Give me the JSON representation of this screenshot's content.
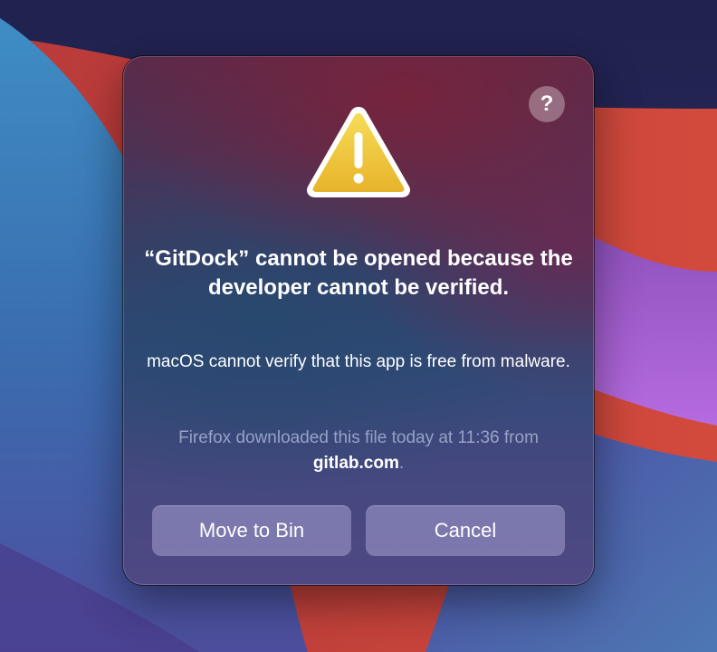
{
  "dialog": {
    "help_label": "?",
    "title": "“GitDock” cannot be opened because the developer cannot be verified.",
    "message": "macOS cannot verify that this app is free from malware.",
    "source_prefix": "Firefox downloaded this file today at 11:36 from ",
    "source_host": "gitlab.com",
    "source_suffix": ".",
    "buttons": {
      "move_to_bin": "Move to Bin",
      "cancel": "Cancel"
    }
  },
  "icons": {
    "warning": "warning-triangle-icon",
    "help": "question-mark-icon"
  },
  "colors": {
    "warning_fill": "#f2c635",
    "warning_border": "#ffffff",
    "button_fill": "#8e88bf"
  }
}
